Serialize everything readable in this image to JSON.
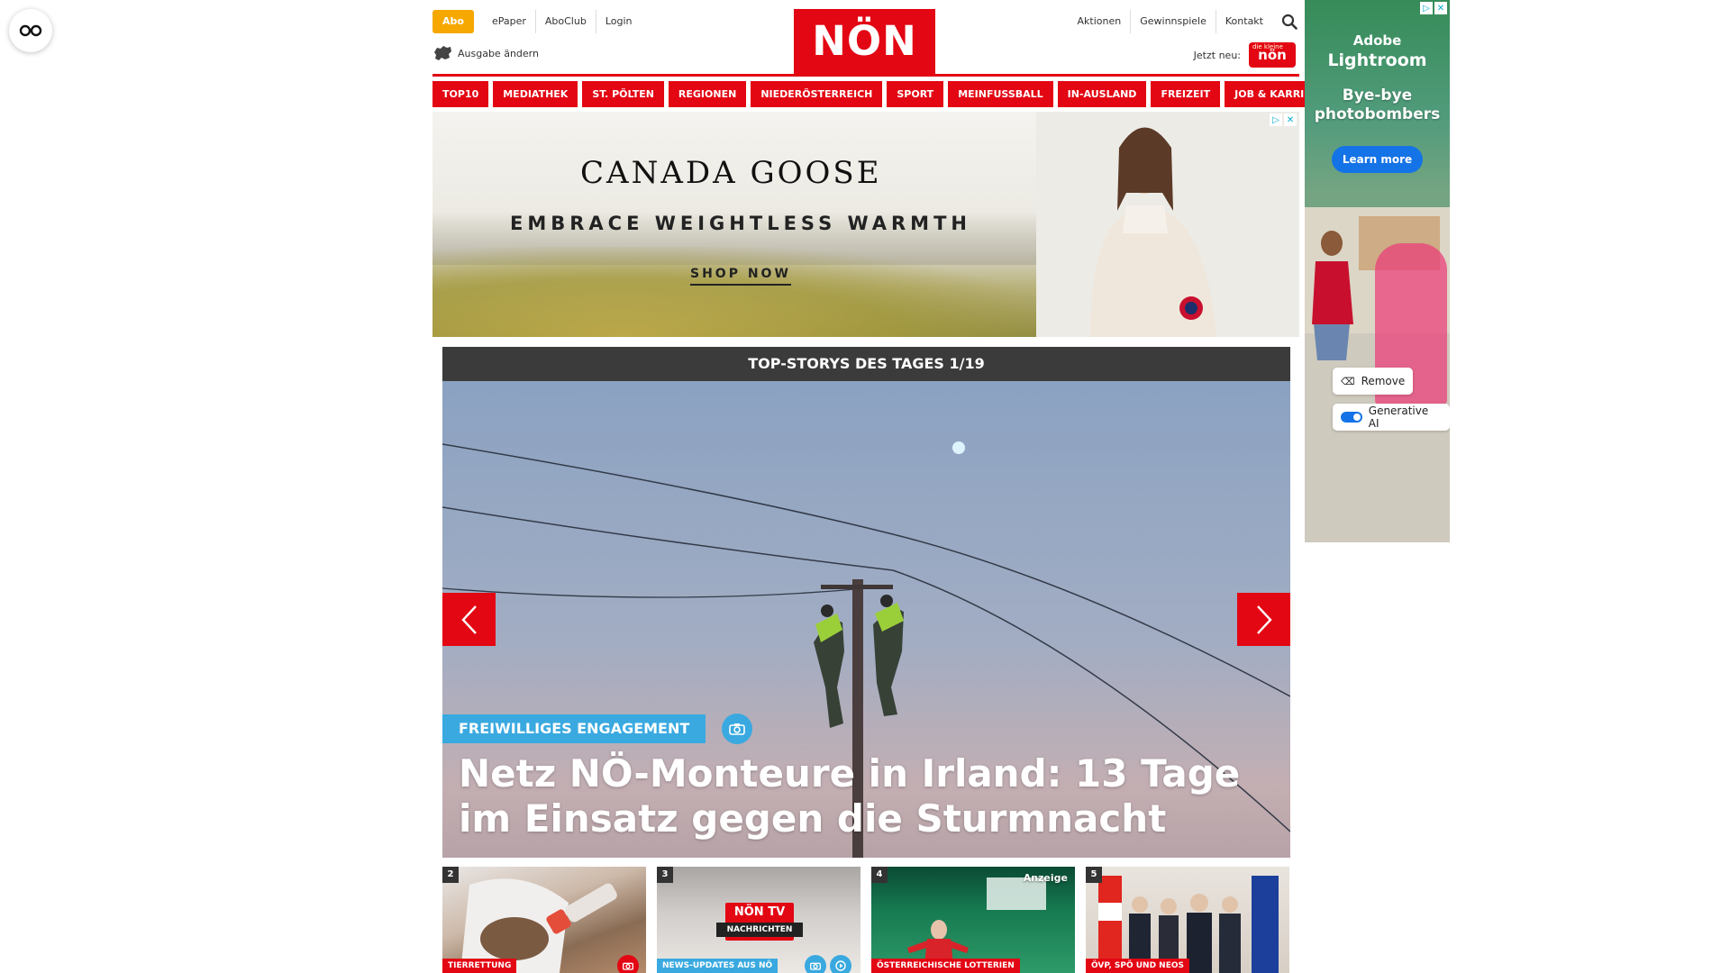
{
  "header": {
    "abo_label": "Abo",
    "links_left": [
      "ePaper",
      "AboClub",
      "Login"
    ],
    "edition_label": "Ausgabe ändern",
    "logo_text": "NÖN",
    "links_right": [
      "Aktionen",
      "Gewinnspiele",
      "Kontakt"
    ],
    "jetzt_neu_label": "Jetzt neu:",
    "kleine_badge_top": "die kleine",
    "kleine_badge_text": "nön",
    "accent_color": "#e30613"
  },
  "nav": {
    "items": [
      "TOP10",
      "MEDIATHEK",
      "ST. PÖLTEN",
      "REGIONEN",
      "NIEDERÖSTERREICH",
      "SPORT",
      "MEINFUSSBALL",
      "IN-AUSLAND",
      "FREIZEIT",
      "JOB & KARRIERE"
    ]
  },
  "banner_ad": {
    "brand": "CANADA GOOSE",
    "tagline": "EMBRACE WEIGHTLESS WARMTH",
    "cta": "SHOP NOW"
  },
  "carousel": {
    "heading": "TOP-STORYS DES TAGES 1/19",
    "category": "FREIWILLIGES ENGAGEMENT",
    "title": "Netz NÖ-Monteure in Irland: 13 Tage im Einsatz gegen die Sturmnacht",
    "tag_color": "#39a9e0"
  },
  "thumbs": [
    {
      "num": "2",
      "category": "TIERRETTUNG",
      "cat_color": "#e30613",
      "label": ""
    },
    {
      "num": "3",
      "category": "NEWS-UPDATES AUS NÖ",
      "cat_color": "#39a9e0",
      "label": "NÖN TV",
      "sub": "NACHRICHTEN"
    },
    {
      "num": "4",
      "category": "ÖSTERREICHISCHE LOTTERIEN",
      "cat_color": "#e30613",
      "anzeige": "Anzeige"
    },
    {
      "num": "5",
      "category": "ÖVP, SPÖ UND NEOS",
      "cat_color": "#e30613"
    }
  ],
  "sky_ad": {
    "brand_line1": "Adobe",
    "brand_line2": "Lightroom",
    "headline": "Bye-bye photobombers",
    "cta": "Learn more",
    "chip_remove": "Remove",
    "chip_genai": "Generative AI"
  }
}
